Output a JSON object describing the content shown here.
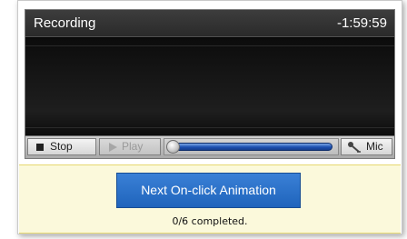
{
  "recorder": {
    "title": "Recording",
    "time_remaining": "-1:59:59",
    "controls": {
      "stop_label": "Stop",
      "play_label": "Play",
      "mic_label": "Mic",
      "stop_icon": "stop-square-icon",
      "play_icon": "play-triangle-icon",
      "mic_icon": "microphone-icon",
      "seek_position": 0.0
    }
  },
  "notice": {
    "next_button_label": "Next On-click Animation",
    "progress_text": "0/6 completed."
  },
  "colors": {
    "accent_button": "#2a6fc9",
    "notice_background": "#fbf9db",
    "recorder_background": "#000000"
  }
}
